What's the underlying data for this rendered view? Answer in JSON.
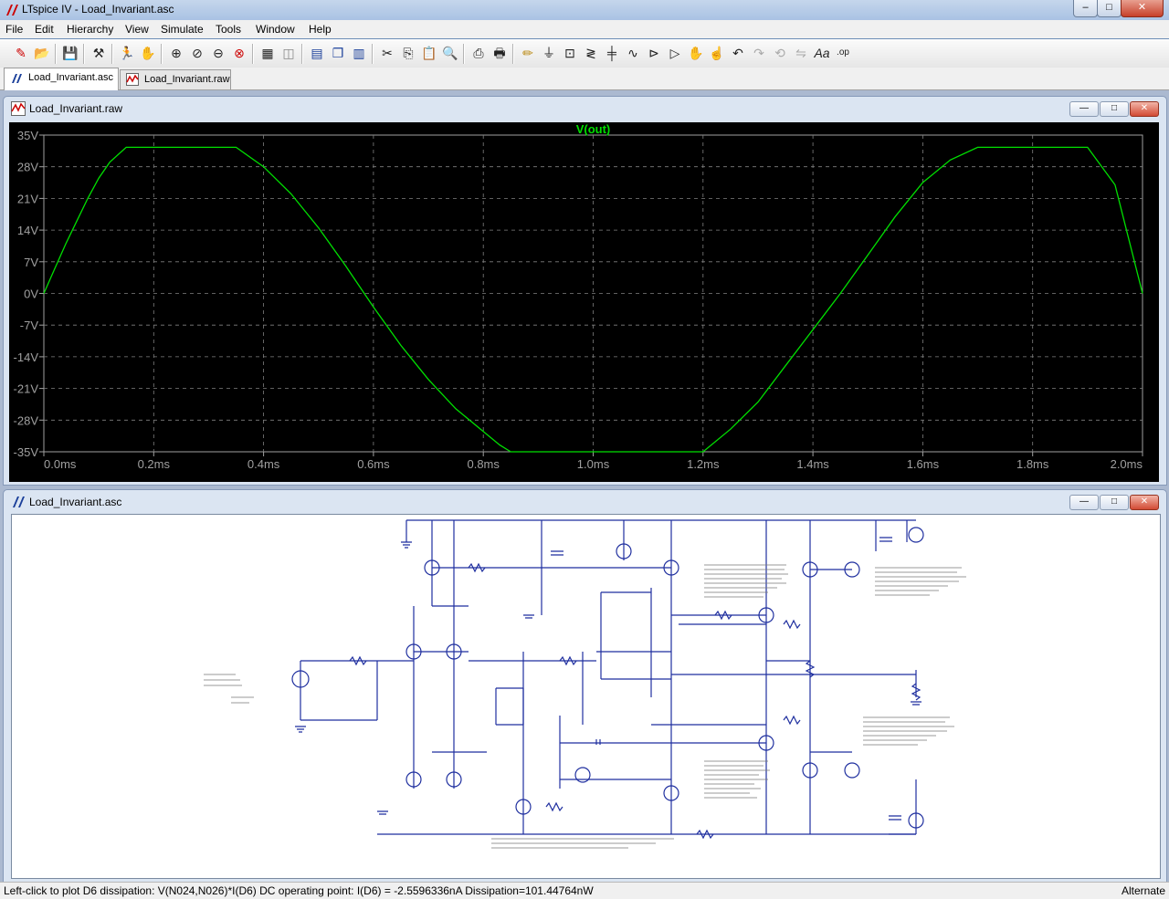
{
  "window": {
    "title": "LTspice IV - Load_Invariant.asc",
    "min": "–",
    "max": "□",
    "close": "✕"
  },
  "menu": [
    "File",
    "Edit",
    "Hierarchy",
    "View",
    "Simulate",
    "Tools",
    "Window",
    "Help"
  ],
  "toolbar_icons": [
    "new-schematic-icon",
    "open-icon",
    "save-icon",
    "control-panel-icon",
    "run-icon",
    "halt-icon",
    "zoom-in-icon",
    "zoom-area-icon",
    "zoom-out-icon",
    "zoom-cancel-icon",
    "autorange-icon",
    "fft-icon",
    "tile-horizontal-icon",
    "cascade-icon",
    "tile-vertical-icon",
    "cut-icon",
    "copy-icon",
    "paste-icon",
    "find-icon",
    "print-setup-icon",
    "print-icon",
    "draw-wire-icon",
    "ground-icon",
    "label-net-icon",
    "resistor-icon",
    "capacitor-icon",
    "inductor-icon",
    "diode-icon",
    "component-icon",
    "move-icon",
    "drag-icon",
    "undo-icon",
    "redo-icon",
    "rotate-icon",
    "mirror-icon",
    "text-icon",
    "spice-directive-icon"
  ],
  "tabs": [
    {
      "label": "Load_Invariant.asc",
      "active": true
    },
    {
      "label": "Load_Invariant.raw",
      "active": false
    }
  ],
  "plot_window": {
    "title": "Load_Invariant.raw"
  },
  "schematic_window": {
    "title": "Load_Invariant.asc"
  },
  "child_buttons": {
    "min": "—",
    "max": "□",
    "close": "✕"
  },
  "chart_data": {
    "type": "line",
    "title": "V(out)",
    "series": [
      {
        "name": "V(out)",
        "color": "#00e000",
        "x": [
          0,
          0.02,
          0.04,
          0.06,
          0.08,
          0.1,
          0.12,
          0.15,
          0.2,
          0.25,
          0.3,
          0.35,
          0.4,
          0.45,
          0.5,
          0.55,
          0.6,
          0.65,
          0.68,
          0.7,
          0.75,
          0.8,
          0.83,
          0.85,
          0.9,
          0.95,
          1.0,
          1.05,
          1.1,
          1.15,
          1.2,
          1.25,
          1.3,
          1.35,
          1.4,
          1.45,
          1.5,
          1.55,
          1.6,
          1.65,
          1.7,
          1.75,
          1.8,
          1.83,
          1.85,
          1.9,
          1.95,
          2.0
        ],
        "y": [
          0,
          5.5,
          11,
          16,
          21,
          25.5,
          29,
          32.3,
          32.3,
          32.3,
          32.3,
          32.3,
          28,
          22,
          14.5,
          6,
          -3,
          -11.5,
          -16,
          -19,
          -25.5,
          -30.5,
          -33.5,
          -35,
          -35,
          -35,
          -35,
          -35,
          -35,
          -35,
          -35,
          -30,
          -24,
          -16,
          -8,
          0,
          8.5,
          17,
          24.5,
          29.5,
          32.3,
          32.3,
          32.3,
          32.3,
          32.3,
          32.3,
          24,
          0
        ]
      }
    ],
    "x_ticks": [
      "0.0ms",
      "0.2ms",
      "0.4ms",
      "0.6ms",
      "0.8ms",
      "1.0ms",
      "1.2ms",
      "1.4ms",
      "1.6ms",
      "1.8ms",
      "2.0ms"
    ],
    "y_ticks": [
      "35V",
      "28V",
      "21V",
      "14V",
      "7V",
      "0V",
      "-7V",
      "-14V",
      "-21V",
      "-28V",
      "-35V"
    ],
    "xlim": [
      0,
      2.0
    ],
    "ylim": [
      -35,
      35
    ],
    "grid": true
  },
  "status": {
    "left": "Left-click to plot D6 dissipation: V(N024,N026)*I(D6)  DC operating point: I(D6) = -2.5596336nA   Dissipation=101.44764nW",
    "right": "Alternate"
  }
}
